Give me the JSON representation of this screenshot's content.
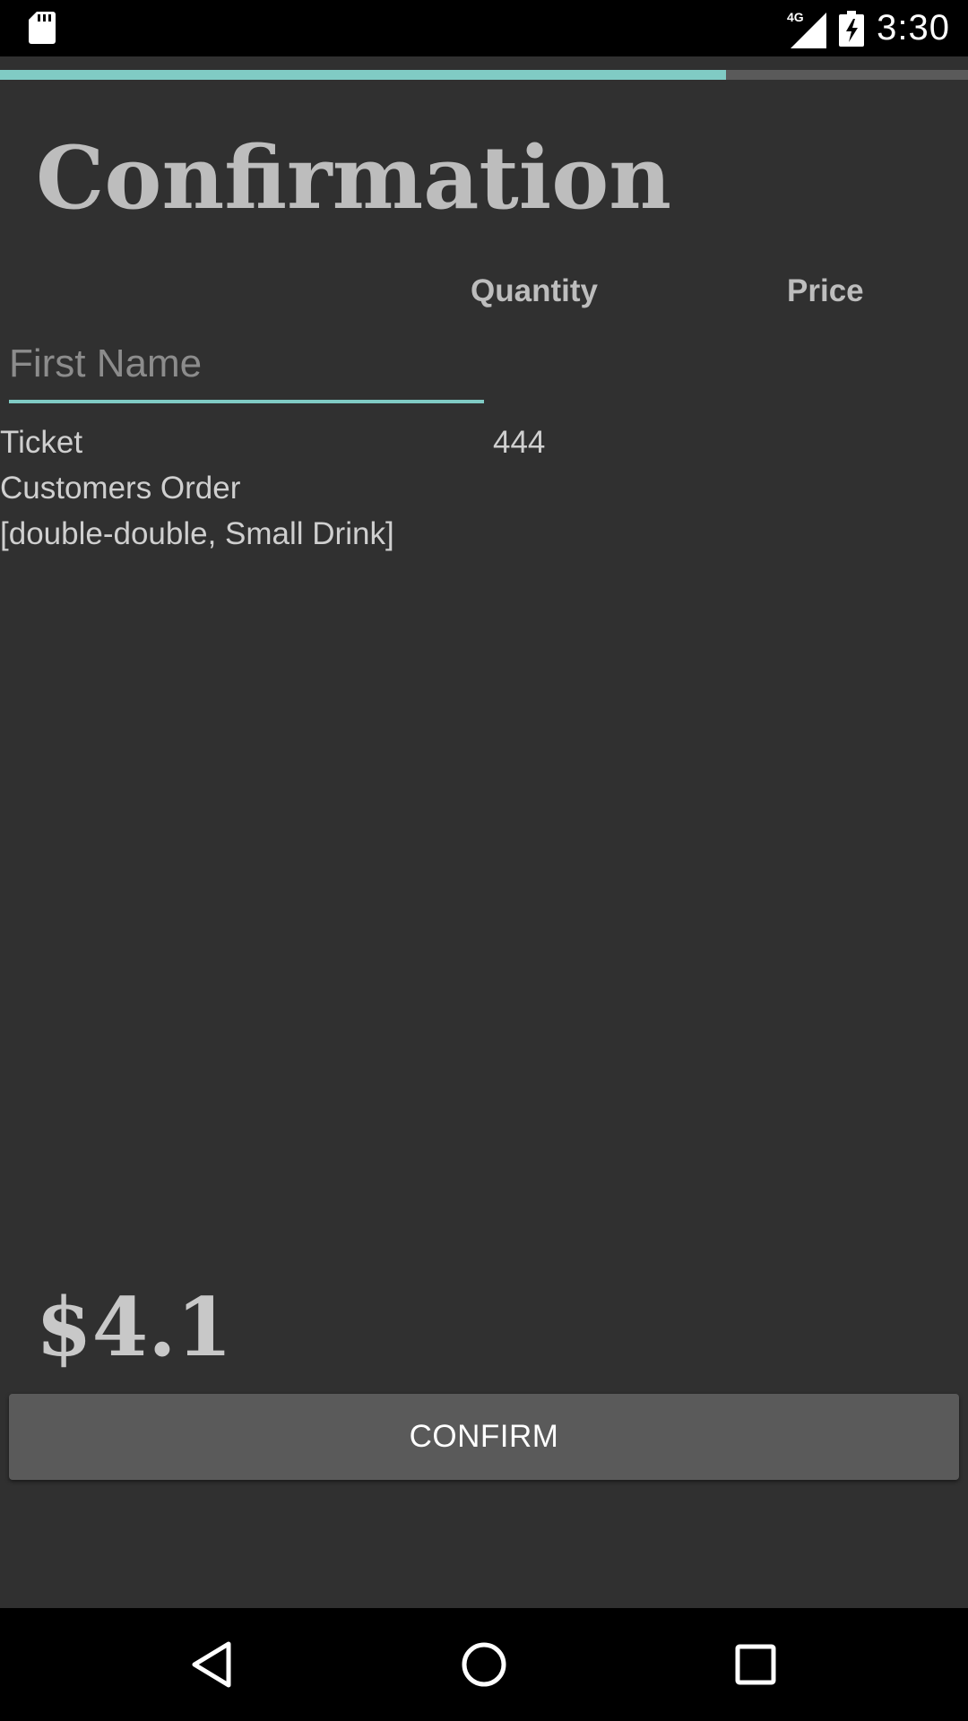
{
  "status_bar": {
    "time": "3:30",
    "network_label": "4G",
    "icons": [
      "sd-card-icon",
      "signal-icon",
      "battery-charging-icon"
    ]
  },
  "progress": {
    "value": 0.75,
    "fill_color": "#80cbc4",
    "track_color": "#5a5a5a"
  },
  "page": {
    "title": "Confirmation",
    "columns": {
      "quantity": "Quantity",
      "price": "Price"
    }
  },
  "form": {
    "first_name": {
      "value": "",
      "placeholder": "First Name"
    }
  },
  "details": {
    "ticket_label": "Ticket",
    "ticket_value": "444",
    "order_label": "Customers Order",
    "order_items": "[double-double, Small Drink]"
  },
  "total": "$4.1",
  "actions": {
    "confirm_label": "CONFIRM"
  },
  "nav_bar": {
    "icons": [
      "back-icon",
      "home-icon",
      "recents-icon"
    ]
  },
  "colors": {
    "background": "#303030",
    "accent": "#80cbc4",
    "button": "#5a5a5a"
  }
}
